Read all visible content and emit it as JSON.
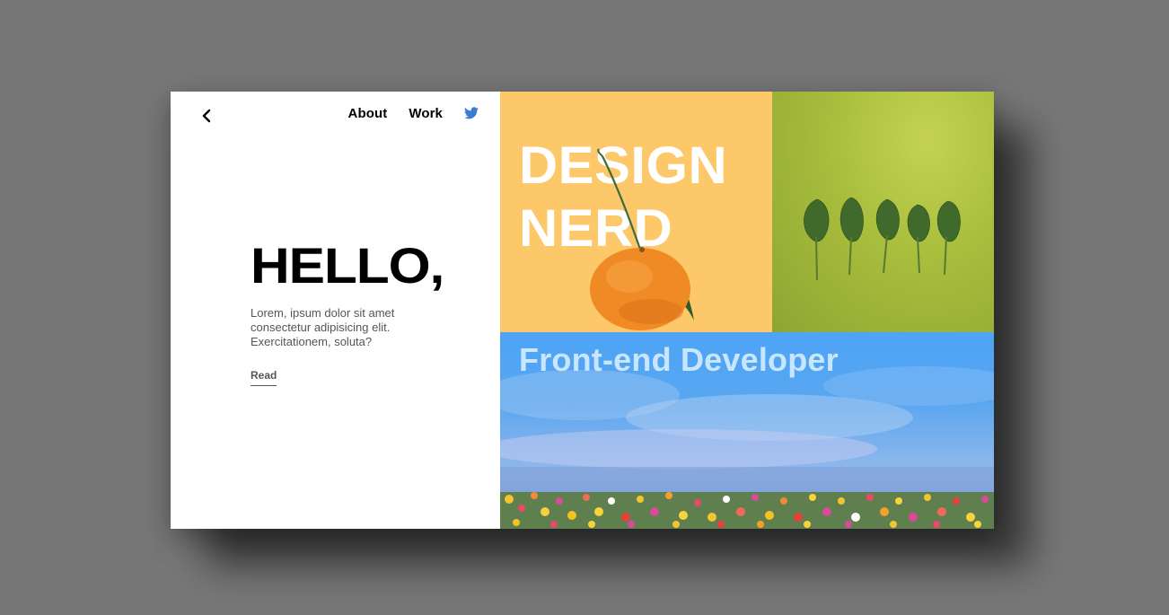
{
  "nav": {
    "back_icon": "chevron-left-icon",
    "about_label": "About",
    "work_label": "Work",
    "twitter_icon": "twitter-icon",
    "twitter_color": "#3b7bd4"
  },
  "hero": {
    "title": "HELLO,",
    "body": "Lorem, ipsum dolor sit amet consectetur adipisicing elit. Exercitationem, soluta?",
    "cta_label": "Read"
  },
  "tiles": {
    "design": {
      "line1": "DESIGN",
      "line2": "NERD",
      "bg": "#fcc86a",
      "image": "mandarin-orange"
    },
    "leaves": {
      "bg": "#a8bd3c",
      "image": "spinach-leaves"
    },
    "developer": {
      "title": "Front-end Developer",
      "bg": "#58a6f0",
      "image": "flower-field-painting"
    }
  },
  "colors": {
    "background": "#777777",
    "card": "#ffffff",
    "text": "#000000"
  }
}
